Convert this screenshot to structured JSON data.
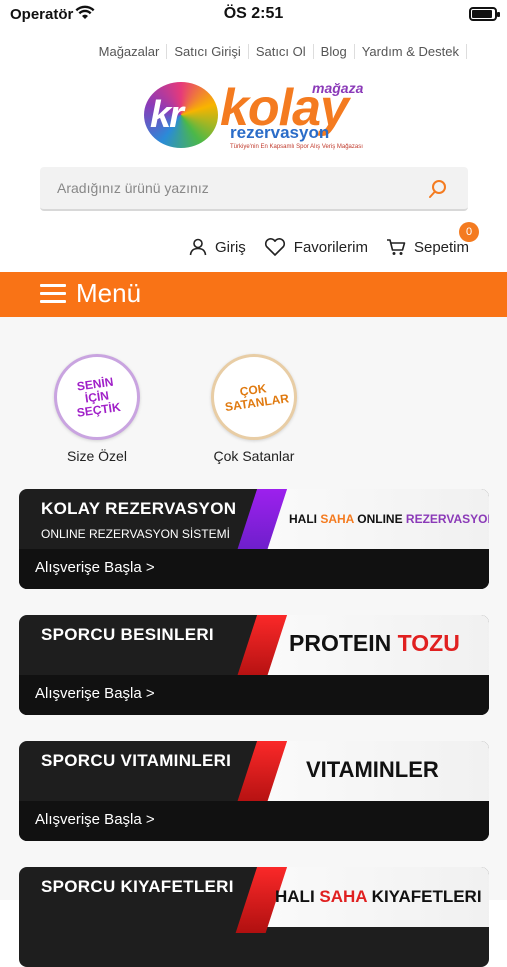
{
  "status_bar": {
    "carrier": "Operatör",
    "time": "ÖS 2:51"
  },
  "top_links": [
    "Mağazalar",
    "Satıcı Girişi",
    "Satıcı Ol",
    "Blog",
    "Yardım & Destek"
  ],
  "logo": {
    "blob_text": "kr",
    "main": "kolay",
    "small": "mağaza",
    "sub": "rezervasyon",
    "tagline": "Türkiye'nin En Kapsamlı Spor Alış Veriş Mağazası"
  },
  "search": {
    "placeholder": "Aradığınız ürünü yazınız"
  },
  "actions": {
    "login": "Giriş",
    "favorites": "Favorilerim",
    "cart": "Sepetim",
    "cart_count": "0"
  },
  "menu": {
    "label": "Menü"
  },
  "categories": [
    {
      "badge": "SENİN İÇİN SEÇTİK",
      "label": "Size Özel"
    },
    {
      "badge": "ÇOK SATANLAR",
      "label": "Çok Satanlar"
    }
  ],
  "banners": [
    {
      "title": "KOLAY REZERVASYON",
      "subtitle": "ONLINE REZERVASYON SİSTEMİ",
      "cta": "Alışverişe Başla >",
      "promo_a": "HALI ",
      "promo_b": "SAHA",
      "promo_c": " ONLINE ",
      "promo_d": "REZERVASYON"
    },
    {
      "title": "SPORCU BESINLERI",
      "cta": "Alışverişe Başla >",
      "promo_a": "PROTEIN ",
      "promo_b": "TOZU"
    },
    {
      "title": "SPORCU VITAMINLERI",
      "cta": "Alışverişe Başla >",
      "promo_a": "VITAMINLER"
    },
    {
      "title": "SPORCU KIYAFETLERI",
      "promo_a": "HALI ",
      "promo_b": "SAHA",
      "promo_c": " KIYAFETLERI"
    }
  ],
  "colors": {
    "accent": "#f97316",
    "dark": "#1e1e1e",
    "purple": "#8b3ab8",
    "red": "#e02020"
  }
}
